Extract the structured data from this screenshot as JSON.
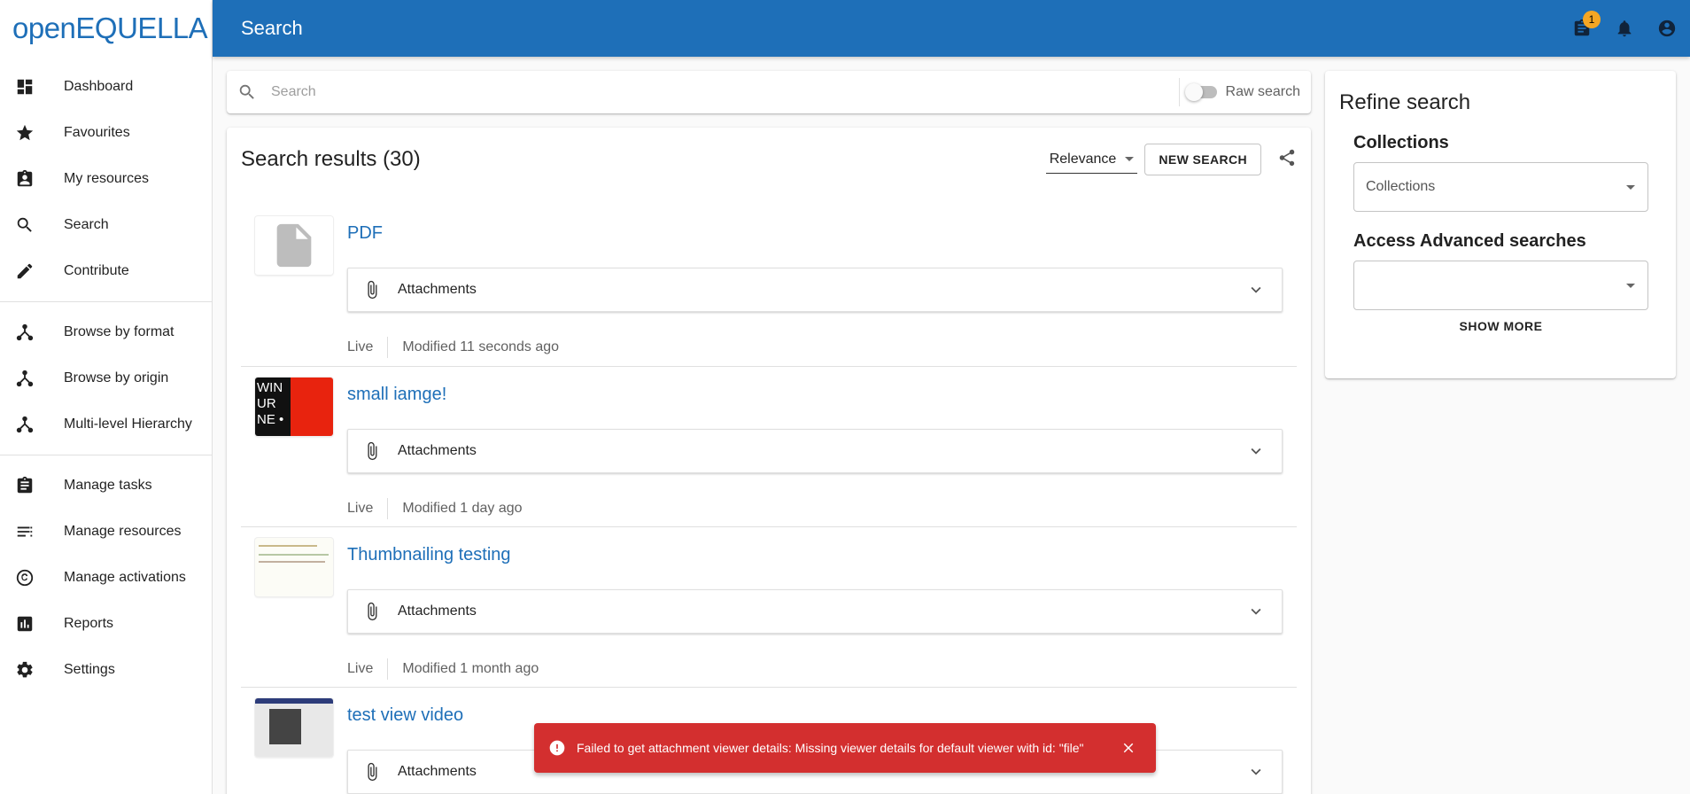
{
  "logo": {
    "part1": "open",
    "part2": "EQUELLA"
  },
  "sidebar": {
    "groups": [
      [
        {
          "label": "Dashboard",
          "icon": "dashboard-icon"
        },
        {
          "label": "Favourites",
          "icon": "star-icon"
        },
        {
          "label": "My resources",
          "icon": "assignment-ind-icon"
        },
        {
          "label": "Search",
          "icon": "search-icon"
        },
        {
          "label": "Contribute",
          "icon": "pencil-icon"
        }
      ],
      [
        {
          "label": "Browse by format",
          "icon": "hierarchy-icon"
        },
        {
          "label": "Browse by origin",
          "icon": "hierarchy-icon"
        },
        {
          "label": "Multi-level Hierarchy",
          "icon": "hierarchy-icon"
        }
      ],
      [
        {
          "label": "Manage tasks",
          "icon": "clipboard-icon"
        },
        {
          "label": "Manage resources",
          "icon": "list-icon"
        },
        {
          "label": "Manage activations",
          "icon": "copyright-icon"
        },
        {
          "label": "Reports",
          "icon": "bar-chart-icon"
        },
        {
          "label": "Settings",
          "icon": "gear-icon"
        }
      ]
    ]
  },
  "topbar": {
    "title": "Search",
    "tasks_badge": "1"
  },
  "search": {
    "placeholder": "Search",
    "raw_label": "Raw search"
  },
  "results": {
    "title": "Search results (30)",
    "sort_value": "Relevance",
    "new_search_label": "NEW SEARCH",
    "items": [
      {
        "title": "PDF",
        "attachments_label": "Attachments",
        "status": "Live",
        "modified": "Modified 11 seconds ago"
      },
      {
        "title": "small iamge!",
        "attachments_label": "Attachments",
        "status": "Live",
        "modified": "Modified 1 day ago"
      },
      {
        "title": "Thumbnailing testing",
        "attachments_label": "Attachments",
        "status": "Live",
        "modified": "Modified 1 month ago"
      },
      {
        "title": "test view video",
        "attachments_label": "Attachments",
        "status": "",
        "modified": ""
      }
    ]
  },
  "refine": {
    "title": "Refine search",
    "collections_label": "Collections",
    "collections_value": "Collections",
    "advanced_label": "Access Advanced searches",
    "advanced_value": "",
    "show_more": "SHOW MORE"
  },
  "snackbar": {
    "message": "Failed to get attachment viewer details: Missing viewer details for default viewer with id: \"file\""
  },
  "colors": {
    "brand": "#1e6fb8",
    "error": "#d32f2f",
    "badge": "#f5a623"
  }
}
